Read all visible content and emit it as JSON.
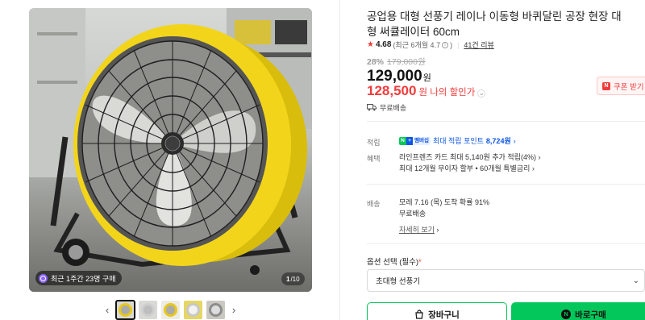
{
  "gallery": {
    "purchase_badge": "최근 1주간 23명 구매",
    "counter_current": "1",
    "counter_total": "/10",
    "prev_arrow": "‹",
    "next_arrow": "›"
  },
  "product": {
    "title": "공업용 대형 선풍기 레이나 이동형 바퀴달린 공장 현장 대형 써큘레이터 60cm",
    "rating_score": "4.68",
    "rating_detail": "(최근 6개월 4.7",
    "rating_detail_close": ")",
    "review_link": "41건 리뷰",
    "discount_rate": "28%",
    "original_price": "179,000원",
    "price": "129,000",
    "price_unit": "원",
    "my_price": "128,500",
    "my_price_label": "원 나의 할인가",
    "free_shipping": "무료배송",
    "coupon_label": "쿠폰 받기",
    "coupon_badge": "N"
  },
  "benefits": {
    "points_label": "적립",
    "points_prefix": "최대 적립 포인트",
    "points_amount": "8,724원",
    "np_n": "N",
    "np_plus": "+",
    "np_member": "멤버십",
    "perks_label": "혜택",
    "perk_1": "라인프렌즈 카드 최대 5,140원 추가 적립(4%)",
    "perk_2": "최대 12개월 무이자 할부 • 60개월 특별금리"
  },
  "delivery": {
    "label": "배송",
    "eta": "모레 7.16 (목) 도착 확률 91%",
    "fee": "무료배송",
    "more_link": "자세히 보기"
  },
  "options": {
    "label": "옵션 선택 (필수)",
    "required_mark": "*",
    "selected": "초대형 선풍기"
  },
  "actions": {
    "cart_label": "장바구니",
    "buy_label": "바로구매",
    "buy_icon": "N"
  },
  "colors": {
    "accent_red": "#f03c3c",
    "naver_green": "#03c75a",
    "naver_blue": "#0d56e6",
    "fan_yellow": "#f2d51b"
  }
}
